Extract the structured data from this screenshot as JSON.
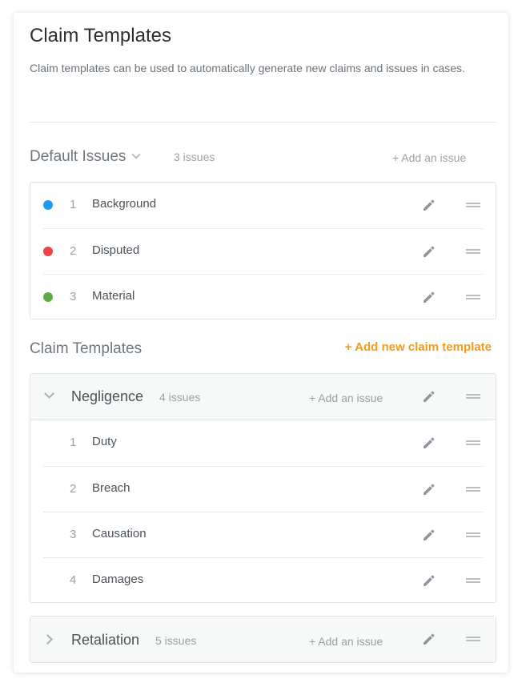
{
  "header": {
    "title": "Claim Templates",
    "description": "Claim templates can be used to automatically generate new claims and issues in cases."
  },
  "default_issues": {
    "title": "Default Issues",
    "count": "3 issues",
    "add_label": "+ Add an issue",
    "items": [
      {
        "num": "1",
        "label": "Background",
        "color": "#1d9bf0"
      },
      {
        "num": "2",
        "label": "Disputed",
        "color": "#ef4444"
      },
      {
        "num": "3",
        "label": "Material",
        "color": "#5cac45"
      }
    ]
  },
  "claim_templates": {
    "title": "Claim Templates",
    "add_label": "+ Add new claim template",
    "templates": [
      {
        "name": "Negligence",
        "count": "4 issues",
        "add_label": "+ Add an issue",
        "expanded": true,
        "items": [
          {
            "num": "1",
            "label": "Duty"
          },
          {
            "num": "2",
            "label": "Breach"
          },
          {
            "num": "3",
            "label": "Causation"
          },
          {
            "num": "4",
            "label": "Damages"
          }
        ]
      },
      {
        "name": "Retaliation",
        "count": "5 issues",
        "add_label": "+ Add an issue",
        "expanded": false
      }
    ]
  },
  "icons": {
    "edit": "pencil-icon",
    "drag": "drag-handle-icon",
    "expand": "chevron-down-icon",
    "collapse": "chevron-right-icon"
  },
  "colors": {
    "accent": "#f39c19",
    "muted": "#9aa1a7",
    "icon": "#8e959b"
  }
}
